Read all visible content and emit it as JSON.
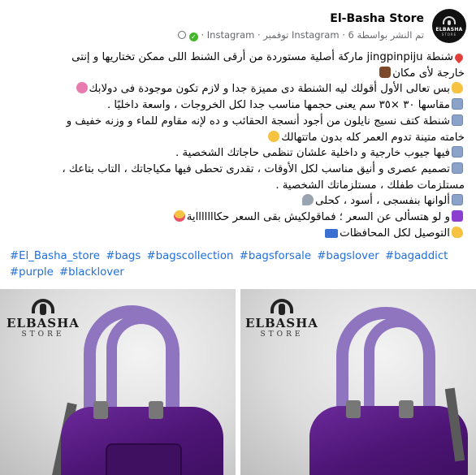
{
  "header": {
    "page_name": "El-Basha Store",
    "meta_text": "تم النشر بواسطة Instagram · 6 توفمبر · Instagram ·",
    "avatar_brand": "ELBASHA",
    "avatar_sub": "STORE"
  },
  "post": {
    "lines": [
      "شنطة jingpinpiju ماركة أصلية مستوردة من أرقى الشنط اللى ممكن تختاريها و إنتى",
      "خارجة لأى مكان",
      "بس تعالى الأول أقولك ليه الشنطة دى مميزة جدا و لازم تكون موجودة فى دولابك",
      "مقاسها ٣٠ ×٣٥ سم يعنى حجمها مناسب جدا لكل الخروجات ، واسعة داخليًا .",
      "شنطة كتف نسيج نايلون من أجود أنسجة الحقائب و ده لإنه مقاوم للماء و وزنه خفيف و",
      "خامته متينة تدوم العمر كله بدون ماتتهالك",
      "فيها جيوب خارجية و داخلية علشان تنظمى حاجاتك الشخصية .",
      "تصميم عصرى و أنيق مناسب لكل الأوقات ، تقدرى تحطى فيها مكياجاتك ، التاب بتاعك ،",
      "مستلزمات طفلك ، مستلزماتك الشخصية .",
      "ألوانها بنفسجى ، أسود ، كحلى",
      "و لو هتسألى عن السعر ؛ فماقولكيش بقى السعر حكاااااااية",
      "التوصيل لكل المحافظات"
    ],
    "hashtags": [
      "#El_Basha_store",
      "#bags",
      "#bagscollection",
      "#bagsforsale",
      "#bagslover",
      "#bagaddict",
      "#purple",
      "#blacklover"
    ]
  },
  "photos": {
    "logo_word": "ELBASHA",
    "logo_sub": "STORE"
  },
  "colors": {
    "link": "#216fdb",
    "bag_purple": "#4c1474",
    "handle_lilac": "#8f74c0"
  }
}
